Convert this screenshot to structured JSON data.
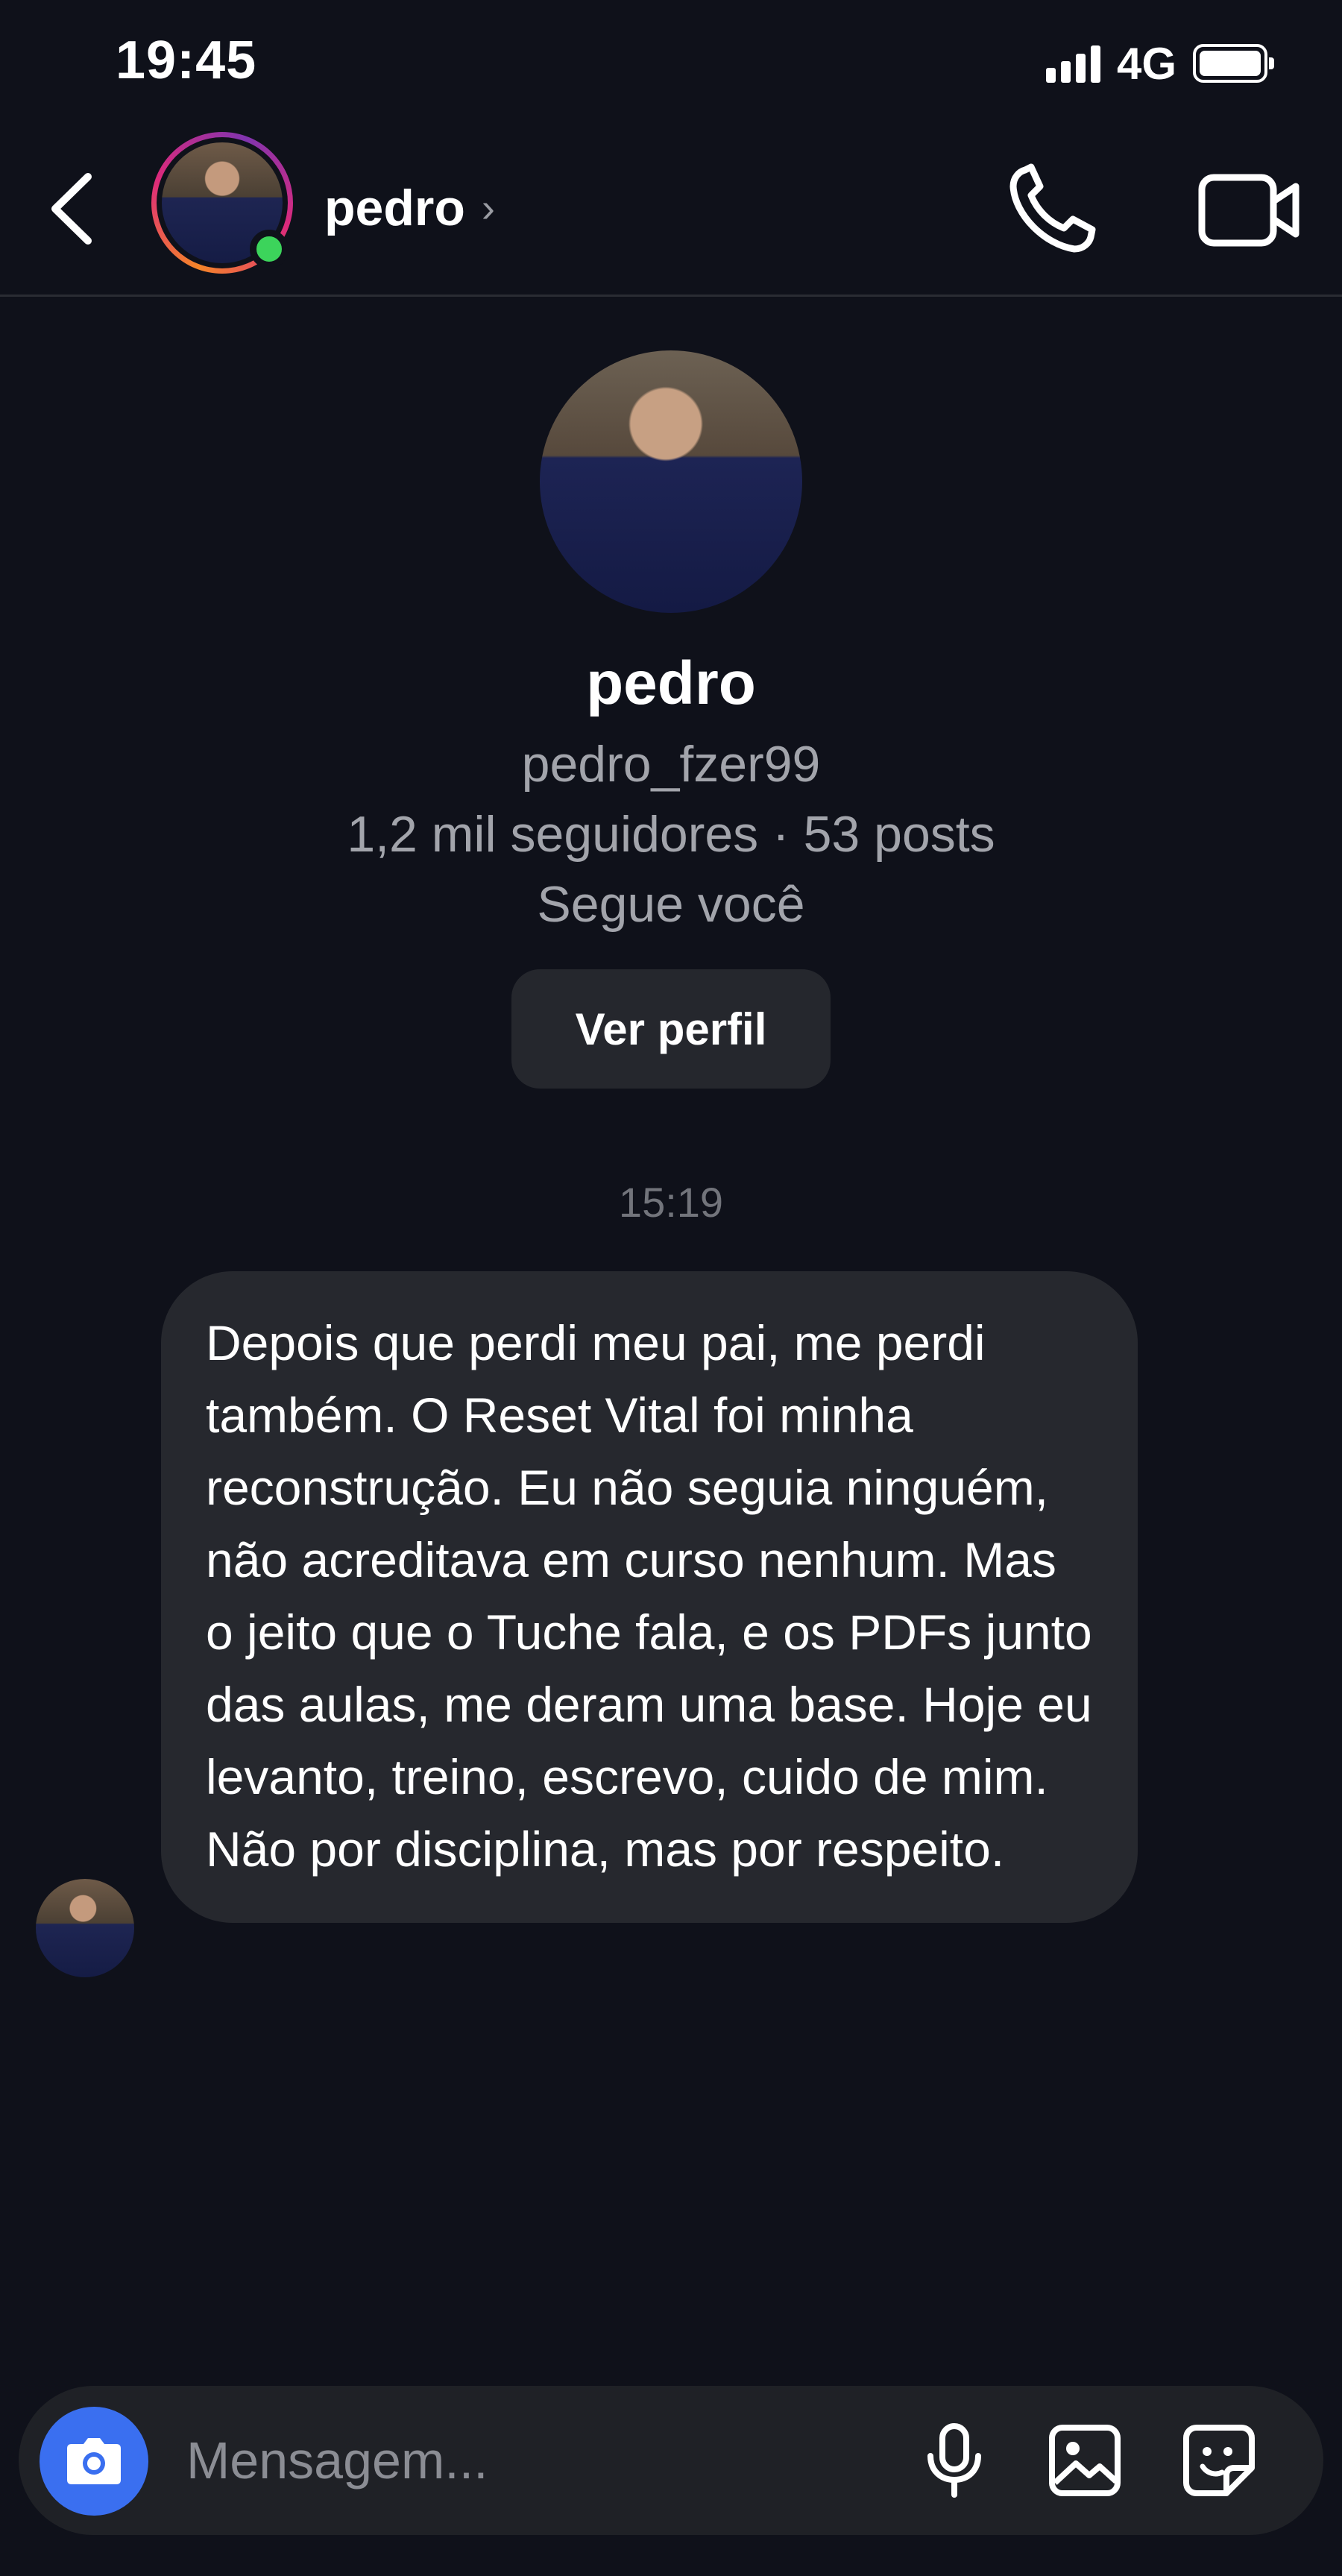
{
  "status_bar": {
    "time": "19:45",
    "network": "4G",
    "icons": [
      "signal-icon",
      "battery-icon"
    ]
  },
  "header": {
    "name": "pedro",
    "chevron": "›",
    "online": true,
    "icons": [
      "back-icon",
      "phone-icon",
      "video-icon"
    ]
  },
  "profile": {
    "name": "pedro",
    "handle": "pedro_fzer99",
    "stats": "1,2 mil seguidores · 53 posts",
    "follows": "Segue você",
    "button_label": "Ver perfil"
  },
  "conversation": {
    "timestamp": "15:19",
    "messages": [
      {
        "sender": "pedro",
        "text": "Depois que perdi meu pai, me perdi também. O Reset Vital foi minha reconstrução. Eu não seguia ninguém, não acreditava em curso nenhum. Mas o jeito que o Tuche fala, e os PDFs junto das aulas, me deram uma base. Hoje eu levanto, treino, escrevo, cuido de mim. Não por disciplina, mas por respeito."
      }
    ]
  },
  "composer": {
    "placeholder": "Mensagem...",
    "value": "",
    "icons": [
      "camera-icon",
      "microphone-icon",
      "gallery-icon",
      "sticker-icon"
    ]
  },
  "colors": {
    "background": "#0f111a",
    "bubble": "#26282e",
    "camera_button": "#3a6ff0",
    "online": "#3cd45b"
  }
}
